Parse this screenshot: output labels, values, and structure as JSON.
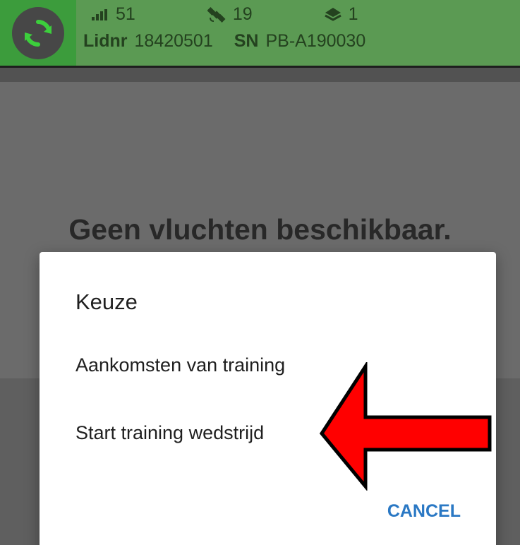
{
  "header": {
    "signal_value": "51",
    "satellites_value": "19",
    "layers_value": "1",
    "member_label": "Lidnr",
    "member_value": "18420501",
    "serial_label": "SN",
    "serial_value": "PB-A190030",
    "colors": {
      "bar": "#5b9a53",
      "sync_box": "#3c9c3c",
      "text": "#24421f"
    },
    "icons": [
      "sync-icon",
      "signal-bars-icon",
      "satellite-icon",
      "layers-icon"
    ]
  },
  "main": {
    "empty_message": "Geen vluchten beschikbaar."
  },
  "dialog": {
    "title": "Keuze",
    "options": [
      {
        "label": "Aankomsten van training"
      },
      {
        "label": "Start training wedstrijd"
      }
    ],
    "cancel_label": "CANCEL",
    "accent_color": "#2a78c4"
  },
  "annotation": {
    "type": "red-arrow",
    "points_to": "Start training wedstrijd",
    "color": "#ff0000"
  }
}
